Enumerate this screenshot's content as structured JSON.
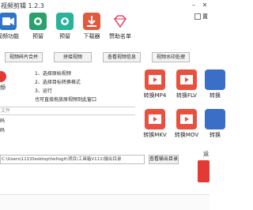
{
  "window": {
    "title": "视频剪辑 1.2.3",
    "minimize_icon": "minimize-icon",
    "close_icon": "close-icon"
  },
  "toolbar": {
    "items": [
      {
        "label": "视频功能",
        "icon": "video-icon"
      },
      {
        "label": "预留",
        "icon": "circle-icon"
      },
      {
        "label": "预留",
        "icon": "circle-icon"
      },
      {
        "label": "下载器",
        "icon": "download-icon"
      },
      {
        "label": "赞助名单",
        "icon": "diamond-icon"
      }
    ],
    "checkbox_label": "置"
  },
  "tabs": [
    {
      "label": "视频碎片合并"
    },
    {
      "label": "拼接视频"
    },
    {
      "label": "查看视频信息"
    },
    {
      "label": "视频水印处理"
    }
  ],
  "panel": {
    "left_label": "频",
    "steps": [
      "1、选择原始视频",
      "2、选择目标转换格式",
      "3、运行",
      "也可直接拖放原视频到此窗口"
    ],
    "file_placeholder": "文件",
    "label_a": "码",
    "label_b": "码"
  },
  "converters": [
    {
      "label": "转换MP4",
      "icon": "film-icon"
    },
    {
      "label": "转换FLV",
      "icon": "film-icon"
    },
    {
      "label": "转换",
      "icon": "film-icon"
    },
    {
      "label": "转换MKV",
      "icon": "film-icon"
    },
    {
      "label": "转换MOV",
      "icon": "film-icon"
    },
    {
      "label": "转换",
      "icon": "film-icon"
    }
  ],
  "output": {
    "path": "C:\\Users\\111\\Desktop\\hellogit\\项目\\工具箱V111\\输出目录",
    "button_label": "查看输出目录",
    "run_label": "运"
  },
  "colors": {
    "accent_red": "#e53935",
    "icon_red": "#e8513f",
    "icon_blue": "#2e74c9",
    "icon_green": "#2aa06d"
  }
}
